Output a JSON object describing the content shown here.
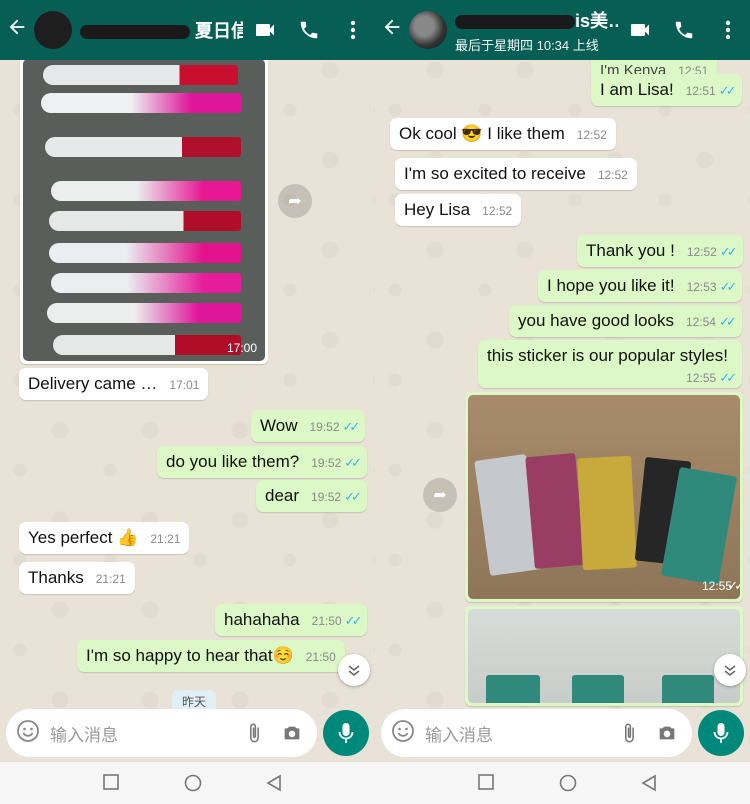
{
  "left": {
    "header": {
      "title": "夏日信保汀…",
      "back_icon": "back-arrow-icon"
    },
    "image1": {
      "time": "17:00"
    },
    "messages": [
      {
        "text": "Delivery came …",
        "time": "17:01",
        "dir": "in"
      },
      {
        "text": "Wow",
        "time": "19:52",
        "dir": "out"
      },
      {
        "text": "do you like them?",
        "time": "19:52",
        "dir": "out"
      },
      {
        "text": "dear",
        "time": "19:52",
        "dir": "out"
      },
      {
        "text": "Yes perfect",
        "emoji": "👍",
        "time": "21:21",
        "dir": "in"
      },
      {
        "text": "Thanks",
        "time": "21:21",
        "dir": "in"
      },
      {
        "text": "hahahaha",
        "time": "21:50",
        "dir": "out"
      },
      {
        "text": "I'm so happy to hear that",
        "emoji": "☺️",
        "time": "21:50",
        "dir": "out"
      }
    ],
    "date_chip": "昨天",
    "input_placeholder": "输入消息"
  },
  "right": {
    "header": {
      "title": "is美…",
      "subtitle": "最后于星期四 10:34 上线"
    },
    "partial_top": "I'm Kenya",
    "partial_top_time": "12:51",
    "messages": [
      {
        "text": "I am Lisa!",
        "time": "12:51",
        "dir": "out"
      },
      {
        "text": "Ok cool",
        "emoji": "😎",
        "text2": "I like them",
        "time": "12:52",
        "dir": "in"
      },
      {
        "text": "I'm so excited to receive",
        "time": "12:52",
        "dir": "in"
      },
      {
        "text": "Hey Lisa",
        "time": "12:52",
        "dir": "in"
      },
      {
        "text": "Thank you !",
        "time": "12:52",
        "dir": "out"
      },
      {
        "text": "I hope you like it!",
        "time": "12:53",
        "dir": "out"
      },
      {
        "text": "you have good looks",
        "time": "12:54",
        "dir": "out"
      },
      {
        "text": "this sticker is our popular styles!",
        "time": "12:55",
        "dir": "out"
      }
    ],
    "image_time": "12:55",
    "input_placeholder": "输入消息"
  },
  "colors": {
    "header": "#075e54",
    "outgoing": "#dcf8c6",
    "incoming": "#ffffff",
    "ticks": "#34b7f1",
    "mic": "#00897b"
  }
}
